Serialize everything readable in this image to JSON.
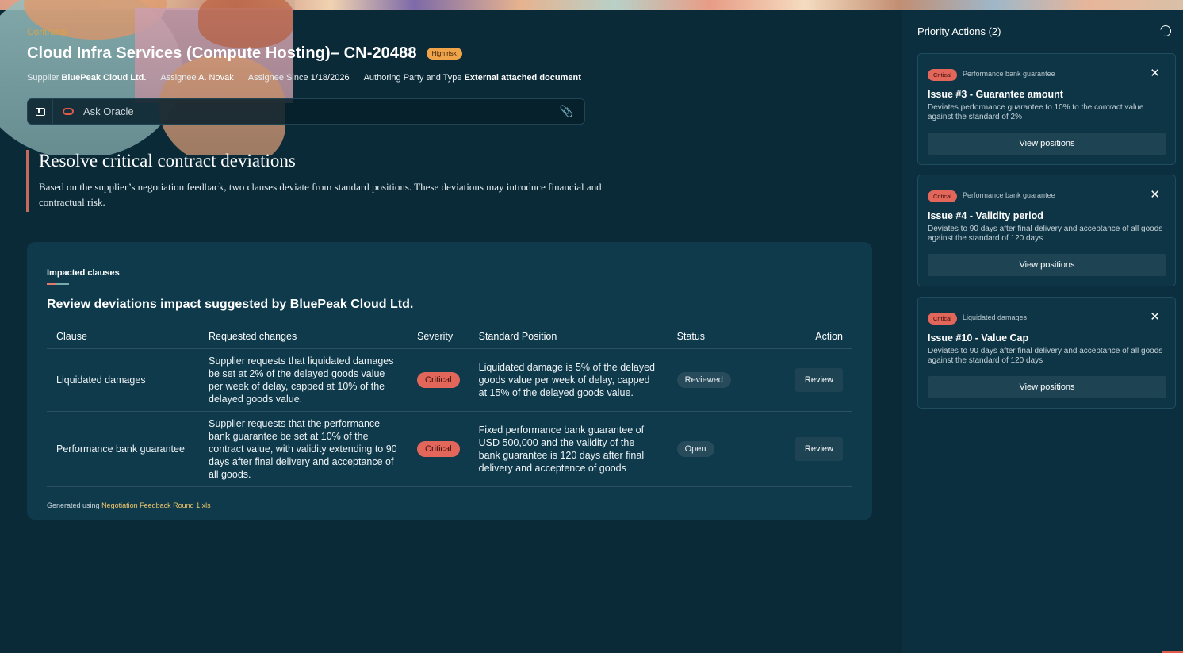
{
  "header": {
    "breadcrumb": "Contracts",
    "title": "Cloud Infra Services (Compute Hosting)– CN-20488",
    "risk_badge": "High risk",
    "meta": {
      "supplier_label": "Supplier",
      "supplier_value": "BluePeak Cloud Ltd.",
      "assignee_label": "Assignee",
      "assignee_value": "A. Novak",
      "assignee_since_label": "Assignee Since",
      "assignee_since_value": "1/18/2026",
      "authoring_label": "Authoring Party and Type",
      "authoring_value": "External attached document"
    }
  },
  "ask": {
    "label": "Ask Oracle"
  },
  "headline": {
    "title": "Resolve critical contract deviations",
    "summary": "Based on the supplier’s negotiation feedback, two clauses deviate from standard positions. These deviations may introduce financial and contractual risk."
  },
  "impacted": {
    "eyebrow": "Impacted clauses",
    "title": "Review deviations impact suggested by BluePeak Cloud Ltd.",
    "columns": [
      "Clause",
      "Requested changes",
      "Severity",
      "Standard Position",
      "Status",
      "Action"
    ],
    "rows": [
      {
        "clause": "Liquidated damages",
        "requested": "Supplier requests that liquidated damages be set at 2% of the delayed goods value per week of delay, capped at 10% of the delayed goods value.",
        "severity": "Critical",
        "standard": "Liquidated damage is 5% of the delayed goods value per week of delay, capped at 15% of the delayed goods value.",
        "status": "Reviewed",
        "action": "Review"
      },
      {
        "clause": "Performance bank guarantee",
        "requested": "Supplier requests that the performance bank guarantee be set at 10% of the contract value, with validity extending to 90 days after final delivery and acceptance of all goods.",
        "severity": "Critical",
        "standard": "Fixed performance bank guarantee of USD 500,000 and the validity of the bank guarantee is 120 days after final delivery and acceptence of goods",
        "status": "Open",
        "action": "Review"
      }
    ],
    "footnote_prefix": "Generated using",
    "footnote_link": "Negotiation Feedback Round 1.xls"
  },
  "panel": {
    "title": "Priority Actions (2)",
    "cards": [
      {
        "severity": "Critical",
        "category": "Performance bank guarantee",
        "issue": "Issue #3 - Guarantee amount",
        "description": "Deviates performance guarantee to 10% to the contract value against the standard of 2%",
        "button": "View positions"
      },
      {
        "severity": "Critical",
        "category": "Performance bank guarantee",
        "issue": "Issue #4 - Validity period",
        "description": "Deviates to 90 days after final delivery and acceptance of all goods against the standard of 120 days",
        "button": "View positions"
      },
      {
        "severity": "Critical",
        "category": "Liquidated damages",
        "issue": "Issue #10 - Value Cap",
        "description": "Deviates to 90 days after final delivery and acceptance of all goods against the standard of 120 days",
        "button": "View positions"
      }
    ]
  },
  "colors": {
    "background": "#0a2a38",
    "card": "#0e3a4c",
    "critical": "#e2665a",
    "risk": "#f0a44a",
    "link": "#f2c66b"
  },
  "icons": [
    "panel-toggle-icon",
    "oracle-logo-icon",
    "paperclip-icon",
    "moon-icon",
    "close-icon"
  ]
}
